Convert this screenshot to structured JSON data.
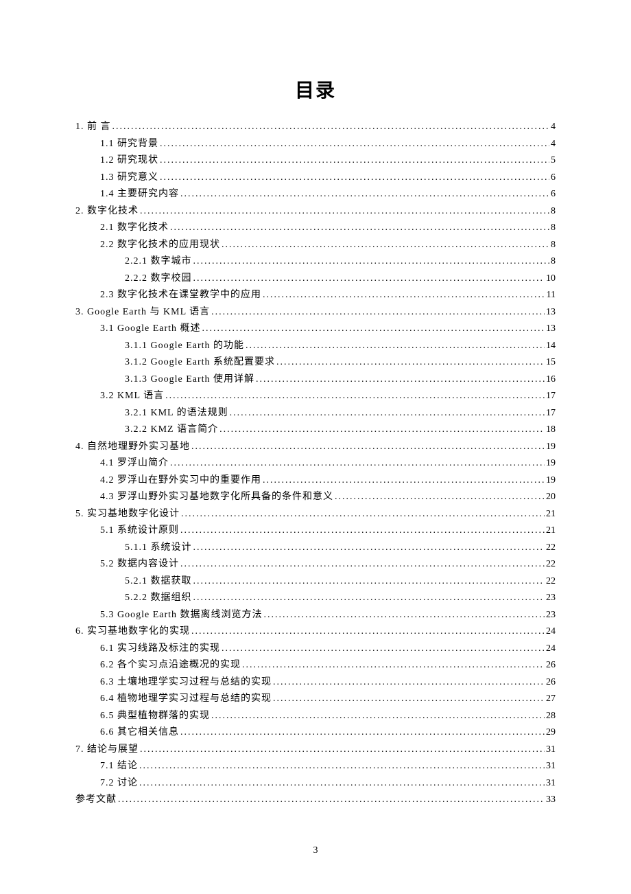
{
  "title": "目录",
  "page_number": "3",
  "entries": [
    {
      "level": 0,
      "label": "1. 前 言",
      "page": "4"
    },
    {
      "level": 1,
      "label": "1.1 研究背景",
      "page": "4"
    },
    {
      "level": 1,
      "label": "1.2 研究现状",
      "page": "5"
    },
    {
      "level": 1,
      "label": "1.3 研究意义",
      "page": "6"
    },
    {
      "level": 1,
      "label": "1.4 主要研究内容",
      "page": "6"
    },
    {
      "level": 0,
      "label": "2.  数字化技术",
      "page": "8"
    },
    {
      "level": 1,
      "label": "2.1 数字化技术",
      "page": "8"
    },
    {
      "level": 1,
      "label": "2.2 数字化技术的应用现状",
      "page": "8"
    },
    {
      "level": 2,
      "label": "2.2.1 数字城市",
      "page": "8"
    },
    {
      "level": 2,
      "label": "2.2.2 数字校园",
      "page": "10"
    },
    {
      "level": 1,
      "label": "2.3 数字化技术在课堂教学中的应用",
      "page": "11"
    },
    {
      "level": 0,
      "label": "3.  Google Earth 与 KML 语言 ",
      "page": "13"
    },
    {
      "level": 1,
      "label": "3.1 Google Earth 概述 ",
      "page": "13"
    },
    {
      "level": 2,
      "label": "3.1.1 Google Earth 的功能",
      "page": "14"
    },
    {
      "level": 2,
      "label": "3.1.2 Google Earth 系统配置要求 ",
      "page": "15"
    },
    {
      "level": 2,
      "label": "3.1.3 Google Earth 使用详解",
      "page": "16"
    },
    {
      "level": 1,
      "label": "3.2 KML 语言 ",
      "page": "17"
    },
    {
      "level": 2,
      "label": "3.2.1 KML 的语法规则 ",
      "page": "17"
    },
    {
      "level": 2,
      "label": "3.2.2 KMZ 语言简介 ",
      "page": "18"
    },
    {
      "level": 0,
      "label": "4.  自然地理野外实习基地",
      "page": "19"
    },
    {
      "level": 1,
      "label": "4.1 罗浮山简介",
      "page": "19"
    },
    {
      "level": 1,
      "label": "4.2 罗浮山在野外实习中的重要作用",
      "page": "19"
    },
    {
      "level": 1,
      "label": "4.3 罗浮山野外实习基地数字化所具备的条件和意义",
      "page": "20"
    },
    {
      "level": 0,
      "label": "5.  实习基地数字化设计",
      "page": "21"
    },
    {
      "level": 1,
      "label": "5.1 系统设计原则",
      "page": "21"
    },
    {
      "level": 2,
      "label": "5.1.1 系统设计",
      "page": "22"
    },
    {
      "level": 1,
      "label": "5.2 数据内容设计",
      "page": "22"
    },
    {
      "level": 2,
      "label": "5.2.1 数据获取",
      "page": "22"
    },
    {
      "level": 2,
      "label": "5.2.2 数据组织",
      "page": "23"
    },
    {
      "level": 1,
      "label": "5.3 Google Earth 数据离线浏览方法",
      "page": "23"
    },
    {
      "level": 0,
      "label": "6.  实习基地数字化的实现",
      "page": "24"
    },
    {
      "level": 1,
      "label": "6.1 实习线路及标注的实现",
      "page": "24"
    },
    {
      "level": 1,
      "label": "6.2 各个实习点沿途概况的实现",
      "page": "26"
    },
    {
      "level": 1,
      "label": "6.3 土壤地理学实习过程与总结的实现",
      "page": "26"
    },
    {
      "level": 1,
      "label": "6.4 植物地理学实习过程与总结的实现",
      "page": "27"
    },
    {
      "level": 1,
      "label": "6.5 典型植物群落的实现",
      "page": "28"
    },
    {
      "level": 1,
      "label": "6.6 其它相关信息",
      "page": "29"
    },
    {
      "level": 0,
      "label": "7.  结论与展望",
      "page": "31"
    },
    {
      "level": 1,
      "label": "7.1 结论",
      "page": "31"
    },
    {
      "level": 1,
      "label": "7.2 讨论",
      "page": "31"
    },
    {
      "level": 0,
      "label": "参考文献",
      "page": "33"
    }
  ]
}
